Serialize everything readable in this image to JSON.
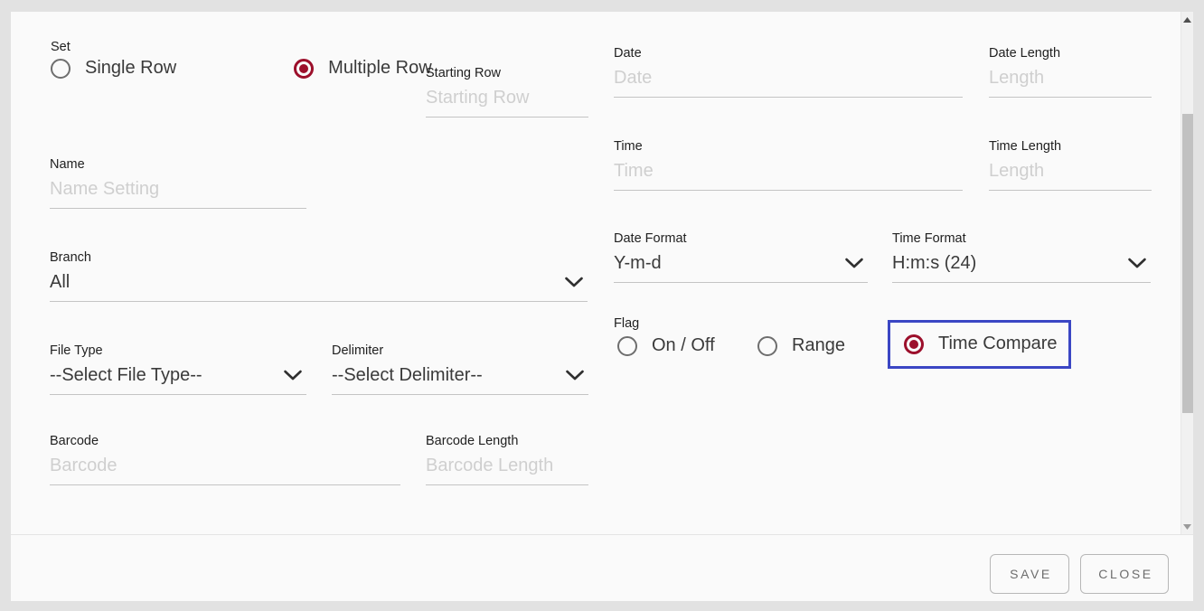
{
  "dialog": {
    "set_group": {
      "caption": "Set",
      "options": [
        {
          "label": "Single Row",
          "checked": false
        },
        {
          "label": "Multiple Row",
          "checked": true
        }
      ]
    },
    "fields": {
      "starting_row": {
        "label": "Starting Row",
        "value": "",
        "placeholder": "Starting Row"
      },
      "name": {
        "label": "Name",
        "value": "",
        "placeholder": "Name Setting"
      },
      "branch": {
        "label": "Branch",
        "value": "All"
      },
      "file_type": {
        "label": "File Type",
        "value": "--Select File Type--"
      },
      "delimiter": {
        "label": "Delimiter",
        "value": "--Select Delimiter--"
      },
      "barcode": {
        "label": "Barcode",
        "value": "",
        "placeholder": "Barcode"
      },
      "barcode_length": {
        "label": "Barcode Length",
        "value": "",
        "placeholder": "Barcode Length"
      },
      "date": {
        "label": "Date",
        "value": "",
        "placeholder": "Date"
      },
      "date_length": {
        "label": "Date Length",
        "value": "",
        "placeholder": "Length"
      },
      "time": {
        "label": "Time",
        "value": "",
        "placeholder": "Time"
      },
      "time_length": {
        "label": "Time Length",
        "value": "",
        "placeholder": "Length"
      },
      "date_format": {
        "label": "Date Format",
        "value": "Y-m-d"
      },
      "time_format": {
        "label": "Time Format",
        "value": "H:m:s (24)"
      }
    },
    "flag_group": {
      "caption": "Flag",
      "options": [
        {
          "label": "On / Off",
          "checked": false,
          "highlighted": false
        },
        {
          "label": "Range",
          "checked": false,
          "highlighted": false
        },
        {
          "label": "Time Compare",
          "checked": true,
          "highlighted": true
        }
      ]
    },
    "footer": {
      "save_label": "SAVE",
      "close_label": "CLOSE"
    },
    "scrollbar": {
      "up_icon": "caret-up-icon",
      "down_icon": "caret-down-icon"
    },
    "colors": {
      "radio_selected": "#9c0f2b",
      "highlight_border": "#3b46c4",
      "page_background": "#e2e2e2",
      "dialog_background": "#fafafa",
      "underline": "#c4c4c4",
      "placeholder_text": "#cfcfcf",
      "scrollbar_thumb": "#c1c1c1"
    }
  }
}
